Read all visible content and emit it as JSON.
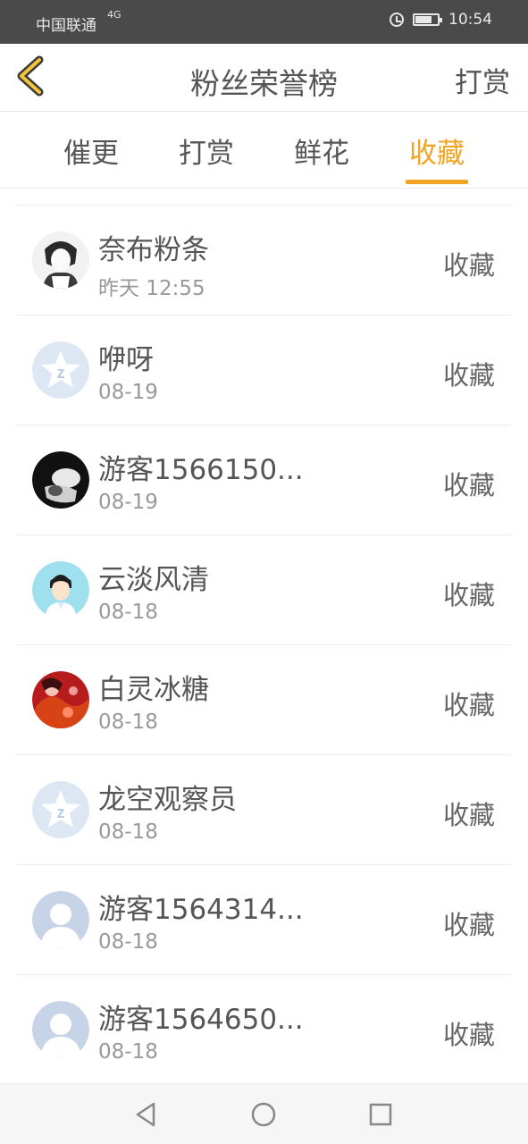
{
  "status": {
    "carrier": "中国联通",
    "network": "4G",
    "time": "10:54"
  },
  "header": {
    "title": "粉丝荣誉榜",
    "action": "打赏"
  },
  "tabs": [
    {
      "label": "催更"
    },
    {
      "label": "打赏"
    },
    {
      "label": "鲜花"
    },
    {
      "label": "收藏"
    }
  ],
  "active_tab": "收藏",
  "colors": {
    "accent": "#f0a422",
    "text": "#555555",
    "muted": "#999999"
  },
  "items": [
    {
      "name": "奈布粉条",
      "date": "昨天 12:55",
      "kind": "收藏",
      "avatar": "anime-photo"
    },
    {
      "name": "咿呀",
      "date": "08-19",
      "kind": "收藏",
      "avatar": "default-qq"
    },
    {
      "name": "游客1566150...",
      "date": "08-19",
      "kind": "收藏",
      "avatar": "dark-photo"
    },
    {
      "name": "云淡风清",
      "date": "08-18",
      "kind": "收藏",
      "avatar": "cartoon-boy"
    },
    {
      "name": "白灵冰糖",
      "date": "08-18",
      "kind": "收藏",
      "avatar": "red-artwork"
    },
    {
      "name": "龙空观察员",
      "date": "08-18",
      "kind": "收藏",
      "avatar": "default-qq"
    },
    {
      "name": "游客1564314...",
      "date": "08-18",
      "kind": "收藏",
      "avatar": "default-person"
    },
    {
      "name": "游客1564650...",
      "date": "08-18",
      "kind": "收藏",
      "avatar": "default-person"
    }
  ]
}
